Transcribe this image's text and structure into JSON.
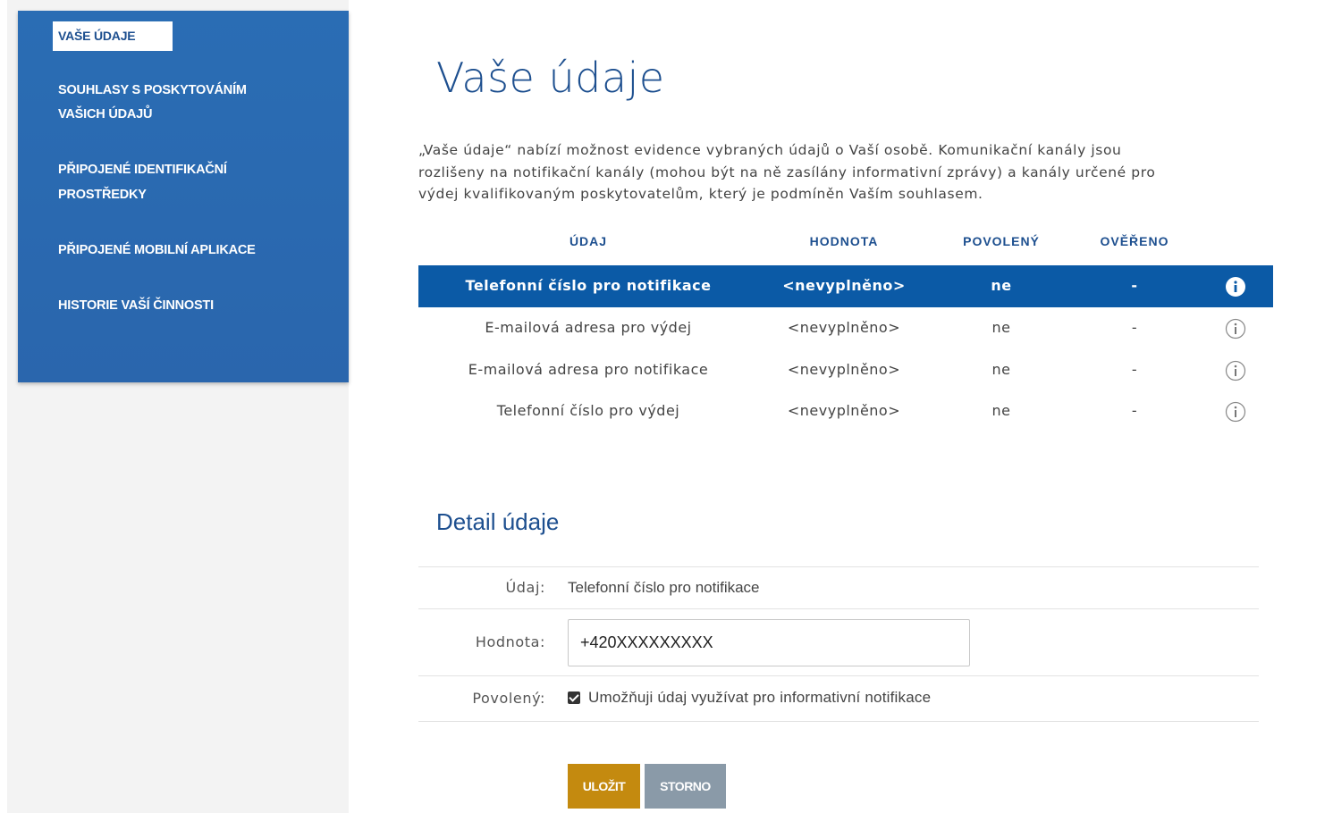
{
  "sidebar": {
    "items": [
      {
        "label": "VAŠE ÚDAJE"
      },
      {
        "label": "SOUHLASY S POSKYTOVÁNÍM",
        "label2": "VAŠICH ÚDAJŮ"
      },
      {
        "label": "PŘIPOJENÉ IDENTIFIKAČNÍ",
        "label2": "PROSTŘEDKY"
      },
      {
        "label": "PŘIPOJENÉ MOBILNÍ APLIKACE"
      },
      {
        "label": "HISTORIE VAŠÍ ČINNOSTI"
      }
    ]
  },
  "main": {
    "title": "Vaše údaje",
    "intro_lines": [
      "„Vaše údaje“ nabízí možnost evidence vybraných údajů o Vaší osobě. Komunikační kanály jsou",
      "rozlišeny na notifikační kanály (mohou být na ně zasílány informativní zprávy) a kanály určené pro",
      "výdej kvalifikovaným poskytovatelům, který je podmíněn Vaším souhlasem."
    ],
    "table": {
      "headers": [
        "ÚDAJ",
        "HODNOTA",
        "POVOLENÝ",
        "OVĚŘENO"
      ],
      "rows": [
        {
          "udaj": "Telefonní číslo pro notifikace",
          "hodnota": "<nevyplněno>",
          "povoleny": "ne",
          "overeno": "-",
          "selected": true
        },
        {
          "udaj": "E-mailová adresa pro výdej",
          "hodnota": "<nevyplněno>",
          "povoleny": "ne",
          "overeno": "-"
        },
        {
          "udaj": "E-mailová adresa pro notifikace",
          "hodnota": "<nevyplněno>",
          "povoleny": "ne",
          "overeno": "-"
        },
        {
          "udaj": "Telefonní číslo pro výdej",
          "hodnota": "<nevyplněno>",
          "povoleny": "ne",
          "overeno": "-"
        }
      ]
    },
    "detail": {
      "title": "Detail údaje",
      "udaj_label": "Údaj:",
      "udaj_value": "Telefonní číslo pro notifikace",
      "hodnota_label": "Hodnota:",
      "hodnota_value": "+420XXXXXXXXX",
      "povoleny_label": "Povolený:",
      "povoleny_checkbox_label": "Umožňuji údaj využívat pro informativní notifikace",
      "povoleny_checked": true
    },
    "buttons": {
      "save": "ULOŽIT",
      "cancel": "STORNO"
    }
  },
  "colors": {
    "brand_blue": "#0b5aa6",
    "sidebar_blue": "#2a6db4",
    "save_button": "#c48a0f",
    "cancel_button": "#8a9aa8"
  },
  "icons": {
    "row_info": "info-circle-icon",
    "checkbox": "checkbox-checked-icon"
  }
}
